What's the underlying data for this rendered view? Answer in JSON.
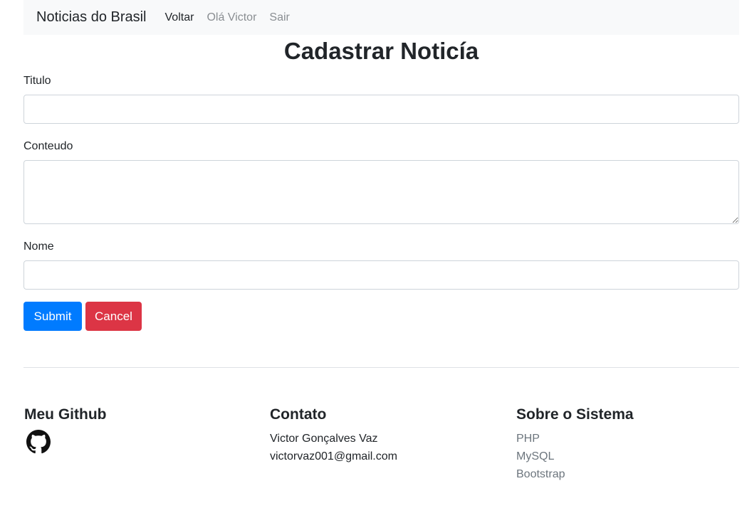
{
  "navbar": {
    "brand": "Noticias do Brasil",
    "links": [
      "Voltar",
      "Olá Victor",
      "Sair"
    ]
  },
  "form": {
    "title": "Cadastrar Noticía",
    "titulo_label": "Titulo",
    "titulo_value": "",
    "conteudo_label": "Conteudo",
    "conteudo_value": "",
    "nome_label": "Nome",
    "nome_value": "",
    "submit_label": "Submit",
    "cancel_label": "Cancel"
  },
  "footer": {
    "github": {
      "heading": "Meu Github",
      "icon": "github-icon"
    },
    "contato": {
      "heading": "Contato",
      "lines": [
        "Victor Gonçalves Vaz",
        "victorvaz001@gmail.com"
      ]
    },
    "sobre": {
      "heading": "Sobre o Sistema",
      "items": [
        "PHP",
        "MySQL",
        "Bootstrap"
      ]
    }
  },
  "colors": {
    "primary": "#007bff",
    "danger": "#dc3545",
    "navbar_bg": "#f8f9fa",
    "muted": "#6c757d"
  }
}
